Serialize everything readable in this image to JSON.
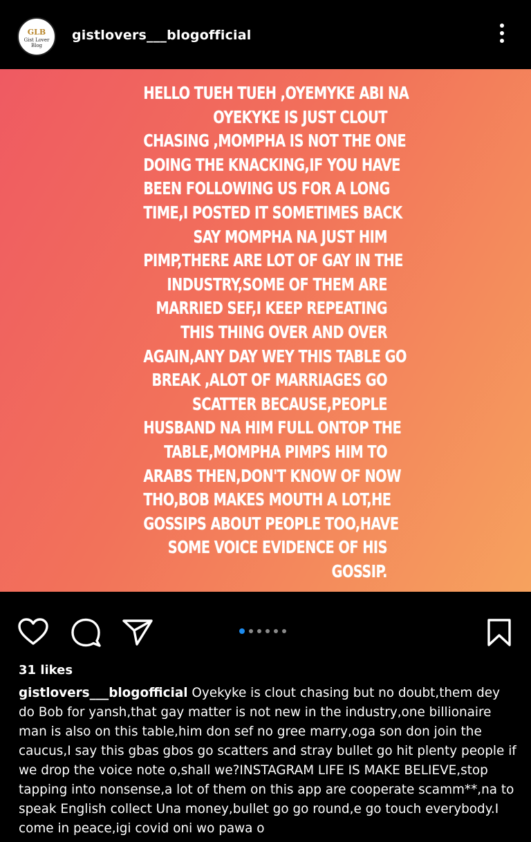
{
  "header": {
    "avatar_text": "GLB",
    "avatar_sub": "Gist Lover Blog",
    "username": "gistlovers___blogofficial",
    "more_icon": "more-vertical-icon"
  },
  "post": {
    "lines": [
      "HELLO TUEH TUEH ,OYEMYKE ABI NA",
      "OYEKYKE IS JUST CLOUT",
      "CHASING ,MOMPHA IS NOT THE ONE",
      "DOING THE KNACKING,IF YOU HAVE",
      "BEEN FOLLOWING US FOR A LONG",
      "TIME,I POSTED IT SOMETIMES BACK",
      "SAY MOMPHA NA JUST HIM",
      "PIMP,THERE ARE LOT OF GAY IN THE",
      "INDUSTRY,SOME OF THEM ARE",
      "MARRIED SEF,I KEEP REPEATING",
      "THIS THING OVER AND OVER",
      "AGAIN,ANY DAY WEY THIS TABLE GO",
      "BREAK ,ALOT OF MARRIAGES GO",
      "SCATTER BECAUSE,PEOPLE",
      "HUSBAND NA HIM FULL ONTOP THE",
      "TABLE,MOMPHA PIMPS HIM TO",
      "ARABS  THEN,DON'T KNOW OF NOW",
      "THO,BOB  MAKES MOUTH A LOT,HE",
      "GOSSIPS ABOUT PEOPLE TOO,HAVE",
      "SOME VOICE EVIDENCE OF HIS",
      "GOSSIP."
    ],
    "gradient_colors": [
      "#ef5a62",
      "#f6a25e"
    ]
  },
  "actions": {
    "like_icon": "heart-icon",
    "comment_icon": "comment-icon",
    "share_icon": "send-icon",
    "save_icon": "bookmark-icon",
    "carousel_count": 6,
    "carousel_active": 1,
    "accent_color": "#1d8cf0"
  },
  "likes": "31 likes",
  "caption": {
    "username": "gistlovers___blogofficial",
    "text": "Oyekyke is clout chasing but no doubt,them dey do Bob for yansh,that gay matter is not new in the industry,one billionaire man is also on this table,him don sef no gree marry,oga son don join the caucus,I say this gbas gbos go scatters and stray bullet go hit plenty people if we drop the voice note o,shall we?INSTAGRAM LIFE IS MAKE BELIEVE,stop tapping into nonsense,a lot of them on this app are cooperate scamm**,na to speak English collect Una money,bullet go go round,e go touch everybody.I come in peace,igi covid oni wo pawa o"
  }
}
